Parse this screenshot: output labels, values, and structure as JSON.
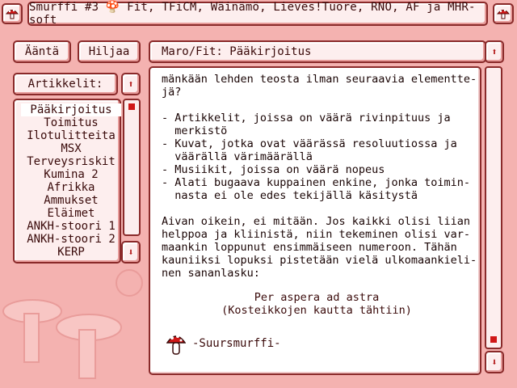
{
  "title": "Smurffi #3 🍄 Fit, TFiCM, Wäinämö, Lieves!Tuore, RNO, AF ja MHR-soft",
  "buttons": {
    "rules": "Ääntä",
    "quiet": "Hiljaa"
  },
  "articles_label": "Artikkelit:",
  "articles": [
    "Pääkirjoitus",
    "Toimitus",
    "Ilotulitteita",
    "MSX",
    "Terveysriskit",
    "Kumina 2",
    "Afrikka",
    "Ammukset",
    "Eläimet",
    "ANKH-stoori 1",
    "ANKH-stoori 2",
    "KERP"
  ],
  "selected_article": "Pääkirjoitus",
  "header": "Maro/Fit: Pääkirjoitus",
  "body_lines": [
    "mänkään lehden teosta ilman seuraavia elementte-",
    "jä?",
    "",
    "- Artikkelit, joissa on väärä rivinpituus ja",
    "  merkistö",
    "- Kuvat, jotka ovat väärässä resoluutiossa ja",
    "  väärällä värimäärällä",
    "- Musiikit, joissa on väärä nopeus",
    "- Alati bugaava kuppainen enkine, jonka toimin-",
    "  nasta ei ole edes tekijällä käsitystä",
    "",
    "Aivan oikein, ei mitään. Jos kaikki olisi liian",
    "helppoa ja kliinistä, niin tekeminen olisi var-",
    "maankin loppunut ensimmäiseen numeroon. Tähän",
    "kauniiksi lopuksi pistetään vielä ulkomaankieli-",
    "nen sananlasku:",
    ""
  ],
  "proverb": "Per aspera ad astra",
  "proverb_translation": "(Kosteikkojen kautta tähtiin)",
  "signature": "-Suursmurffi-",
  "colors": {
    "background": "#f4b2b0",
    "panel": "#fdeeee",
    "border": "#8a2a2a",
    "accent": "#d01818"
  }
}
